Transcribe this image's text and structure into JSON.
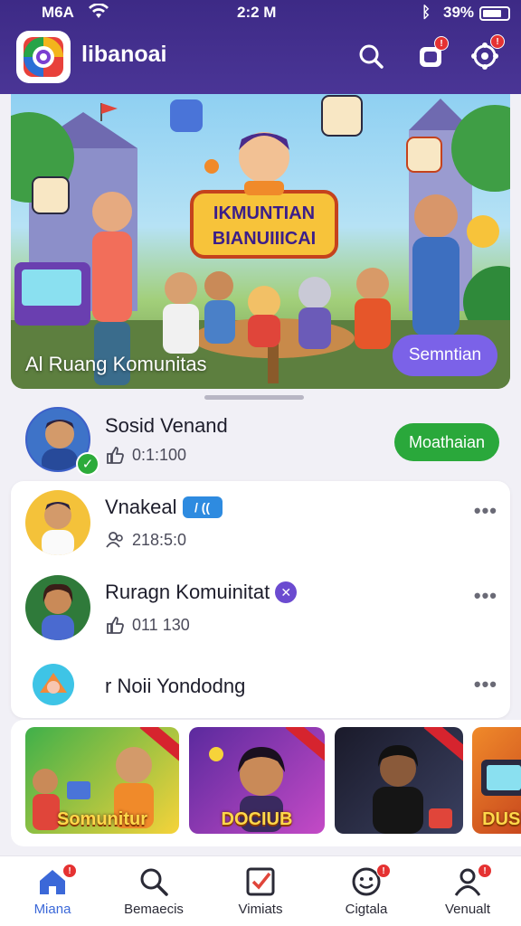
{
  "status_bar": {
    "carrier": "M6A",
    "time": "2:2 M",
    "battery": "39%"
  },
  "header": {
    "app_name": "libanoai",
    "icons": [
      "search-icon",
      "notification-icon",
      "settings-icon"
    ],
    "notification_badge": "!",
    "settings_badge": "!"
  },
  "banner": {
    "sign_line1": "IKMUNTIAN",
    "sign_line2": "BIANUIIICAI",
    "title": "Al Ruang Komunitas",
    "button_label": "Semntian"
  },
  "featured": {
    "name": "Sosid Venand",
    "likes": "0:1:100",
    "button_label": "Moathaian"
  },
  "list": [
    {
      "name": "Vnakeal",
      "tag": "/ ((",
      "meta": "218:5:0",
      "meta_icon": "users-icon"
    },
    {
      "name": "Ruragn Komuinitat",
      "tag": "✕",
      "meta": "011 130",
      "meta_icon": "thumbs-up-icon"
    },
    {
      "name": "r Noii Yondodng",
      "tag": "",
      "meta": "",
      "meta_icon": ""
    }
  ],
  "carousel": [
    {
      "label": "Somunitur"
    },
    {
      "label": "DOCIUB"
    },
    {
      "label": ""
    },
    {
      "label": "DUSI"
    }
  ],
  "bottom_nav": [
    {
      "label": "Miana",
      "icon": "home-icon",
      "active": true,
      "badge": "!"
    },
    {
      "label": "Bemaecis",
      "icon": "search-icon",
      "active": false,
      "badge": ""
    },
    {
      "label": "Vimiats",
      "icon": "checkbox-icon",
      "active": false,
      "badge": ""
    },
    {
      "label": "Cigtala",
      "icon": "smiley-icon",
      "active": false,
      "badge": "!"
    },
    {
      "label": "Venualt",
      "icon": "profile-icon",
      "active": false,
      "badge": "!"
    }
  ],
  "colors": {
    "header": "#3d2a86",
    "accent_purple": "#7b62e8",
    "accent_green": "#2aa83b",
    "nav_active": "#3b68d8",
    "badge": "#e53232"
  }
}
